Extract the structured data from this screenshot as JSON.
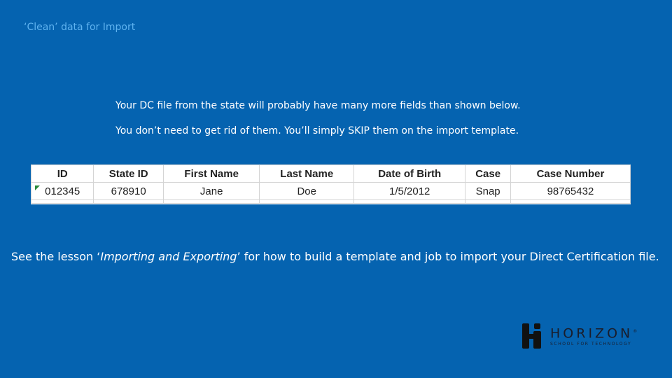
{
  "slide": {
    "title": "‘Clean’ data for Import",
    "intro_lines": [
      "Your DC file from the state will probably have many more fields than shown below.",
      "You don’t need to get rid of them. You’ll simply SKIP them on the import template."
    ],
    "lesson": {
      "prefix": "See the lesson ‘",
      "emphasis": "Importing and Exporting",
      "suffix": "’ for how to build a template and job to import your Direct Certification file."
    }
  },
  "table": {
    "headers": [
      "ID",
      "State ID",
      "First Name",
      "Last Name",
      "Date of Birth",
      "Case",
      "Case Number"
    ],
    "rows": [
      [
        "012345",
        "678910",
        "Jane",
        "Doe",
        "1/5/2012",
        "Snap",
        "98765432"
      ]
    ]
  },
  "logo": {
    "brand": "HORIZON",
    "registered": "®",
    "tagline": "SCHOOL FOR TECHNOLOGY"
  }
}
